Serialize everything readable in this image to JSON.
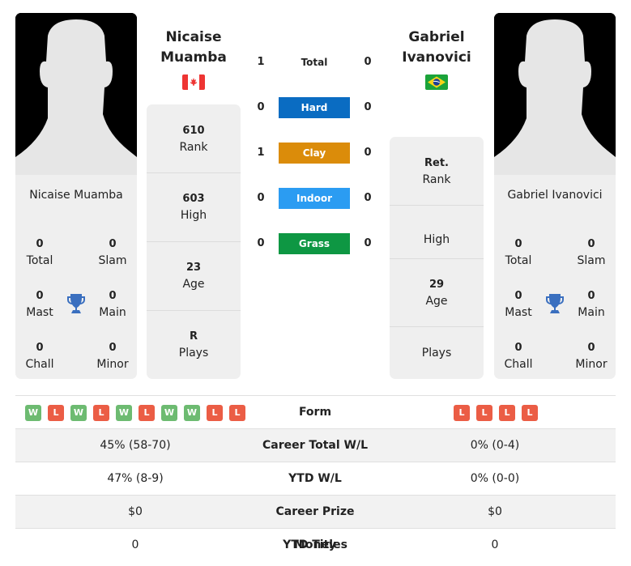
{
  "player1": {
    "name_line1": "Nicaise",
    "name_line2": "Muamba",
    "full_name": "Nicaise Muamba",
    "flag": "canada-flag",
    "photo": "silhouette-placeholder",
    "titles": {
      "total": {
        "value": "0",
        "label": "Total"
      },
      "slam": {
        "value": "0",
        "label": "Slam"
      },
      "mast": {
        "value": "0",
        "label": "Mast"
      },
      "main": {
        "value": "0",
        "label": "Main"
      },
      "chall": {
        "value": "0",
        "label": "Chall"
      },
      "minor": {
        "value": "0",
        "label": "Minor"
      }
    },
    "stats": {
      "rank": {
        "value": "610",
        "label": "Rank"
      },
      "high": {
        "value": "603",
        "label": "High"
      },
      "age": {
        "value": "23",
        "label": "Age"
      },
      "plays": {
        "value": "R",
        "label": "Plays"
      }
    },
    "form": [
      "W",
      "L",
      "W",
      "L",
      "W",
      "L",
      "W",
      "W",
      "L",
      "L"
    ],
    "career_total_wl": "45% (58-70)",
    "ytd_wl": "47% (8-9)",
    "career_prize_money": "$0",
    "ytd_titles": "0"
  },
  "player2": {
    "name_line1": "Gabriel",
    "name_line2": "Ivanovici",
    "full_name": "Gabriel Ivanovici",
    "flag": "brazil-flag",
    "photo": "silhouette-placeholder",
    "titles": {
      "total": {
        "value": "0",
        "label": "Total"
      },
      "slam": {
        "value": "0",
        "label": "Slam"
      },
      "mast": {
        "value": "0",
        "label": "Mast"
      },
      "main": {
        "value": "0",
        "label": "Main"
      },
      "chall": {
        "value": "0",
        "label": "Chall"
      },
      "minor": {
        "value": "0",
        "label": "Minor"
      }
    },
    "stats": {
      "rank": {
        "value": "Ret.",
        "label": "Rank"
      },
      "high": {
        "value": "",
        "label": "High"
      },
      "age": {
        "value": "29",
        "label": "Age"
      },
      "plays": {
        "value": "",
        "label": "Plays"
      }
    },
    "form": [
      "L",
      "L",
      "L",
      "L"
    ],
    "career_total_wl": "0% (0-4)",
    "ytd_wl": "0% (0-0)",
    "career_prize_money": "$0",
    "ytd_titles": "0"
  },
  "h2h": {
    "surfaces": [
      {
        "label": "Total",
        "p1": "1",
        "p2": "0",
        "color": ""
      },
      {
        "label": "Hard",
        "p1": "0",
        "p2": "0",
        "color": "#0a6cc2"
      },
      {
        "label": "Clay",
        "p1": "1",
        "p2": "0",
        "color": "#db8c0a"
      },
      {
        "label": "Indoor",
        "p1": "0",
        "p2": "0",
        "color": "#2b9cf2"
      },
      {
        "label": "Grass",
        "p1": "0",
        "p2": "0",
        "color": "#0e9743"
      }
    ]
  },
  "table_labels": {
    "form": "Form",
    "career_total_wl": "Career Total W/L",
    "ytd_wl": "YTD W/L",
    "career_prize_money": "Career Prize Money",
    "ytd_titles": "YTD Titles"
  },
  "colors": {
    "win": "#6dbb71",
    "loss": "#eb5d45",
    "trophy": "#3a6fbf",
    "card_bg": "#efefef"
  }
}
